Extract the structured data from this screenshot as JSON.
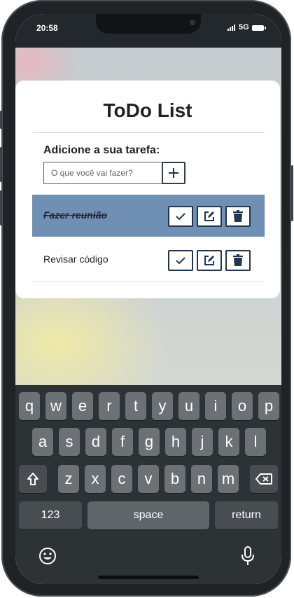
{
  "status_bar": {
    "time": "20:58",
    "network": "5G"
  },
  "app": {
    "title": "ToDo List",
    "add_label": "Adicione a sua tarefa:",
    "input_placeholder": "O que você vai fazer?",
    "tasks": [
      {
        "text": "Fazer reunião",
        "done": true
      },
      {
        "text": "Revisar código",
        "done": false
      }
    ]
  },
  "keyboard": {
    "row1": [
      "q",
      "w",
      "e",
      "r",
      "t",
      "y",
      "u",
      "i",
      "o",
      "p"
    ],
    "row2": [
      "a",
      "s",
      "d",
      "f",
      "g",
      "h",
      "j",
      "k",
      "l"
    ],
    "row3": [
      "z",
      "x",
      "c",
      "v",
      "b",
      "n",
      "m"
    ],
    "numbers_key": "123",
    "space_key": "space",
    "return_key": "return"
  },
  "colors": {
    "done_row": "#6f8fb3",
    "button_border": "#1f3550",
    "keyboard_bg": "#2d3235"
  }
}
